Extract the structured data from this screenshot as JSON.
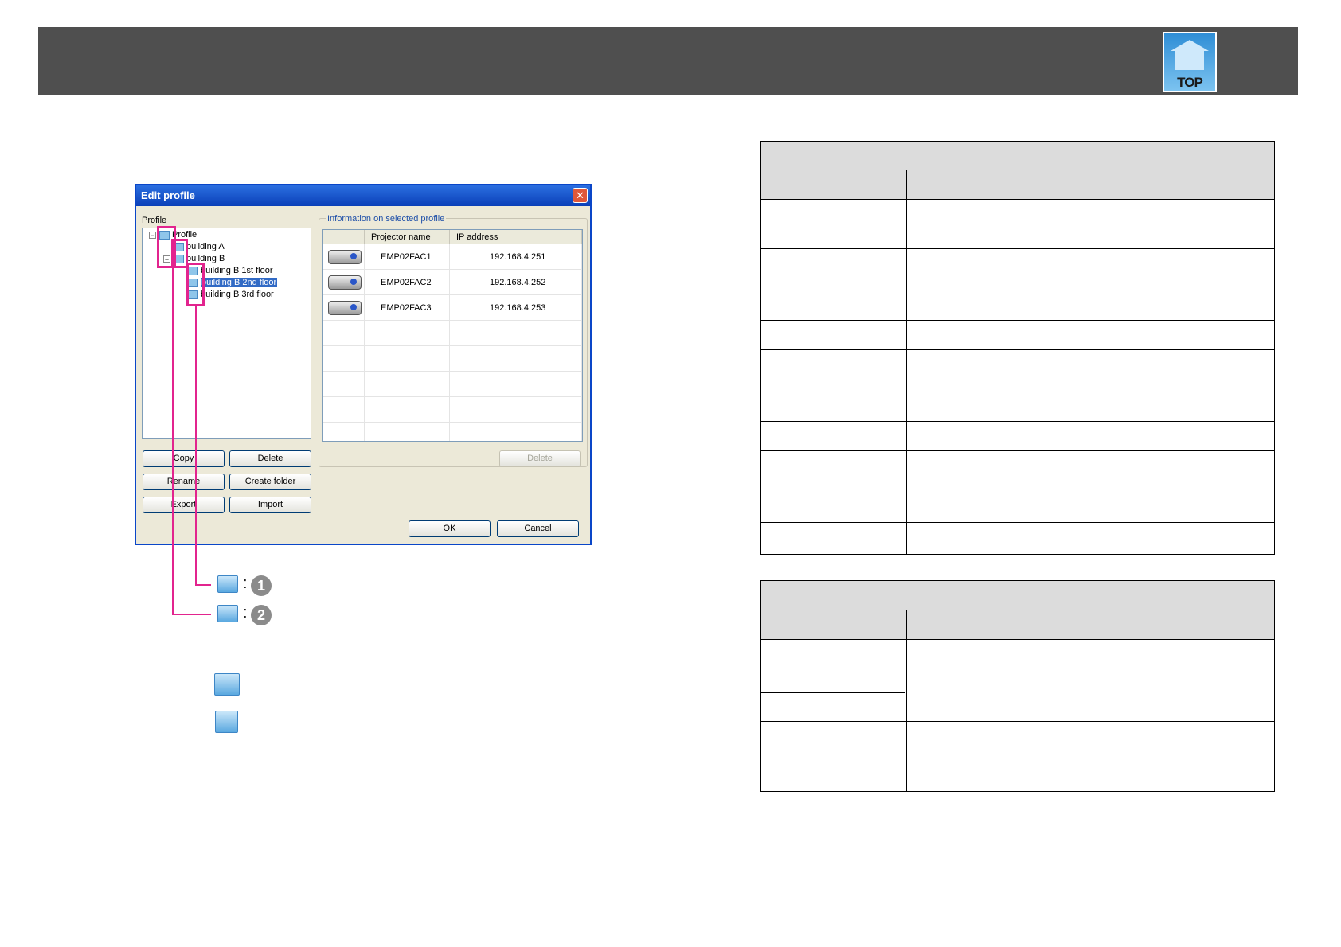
{
  "header": {
    "top_label": "TOP"
  },
  "dialog": {
    "title": "Edit profile",
    "close_glyph": "✕",
    "profile_label": "Profile",
    "info_label": "Information on selected profile",
    "tree": [
      {
        "label": "Profile",
        "expander": "−"
      },
      {
        "label": "building A"
      },
      {
        "label": "building B",
        "expander": "−"
      },
      {
        "label": "building B 1st floor"
      },
      {
        "label": "building B 2nd floor",
        "selected": true
      },
      {
        "label": "building B 3rd floor"
      }
    ],
    "grid": {
      "headers": [
        "",
        "Projector name",
        "IP address"
      ],
      "rows": [
        {
          "name": "EMP02FAC1",
          "ip": "192.168.4.251"
        },
        {
          "name": "EMP02FAC2",
          "ip": "192.168.4.252"
        },
        {
          "name": "EMP02FAC3",
          "ip": "192.168.4.253"
        }
      ]
    },
    "buttons": {
      "copy": "Copy",
      "delete": "Delete",
      "rename": "Rename",
      "create_folder": "Create folder",
      "export": "Export",
      "import": "Import",
      "grid_delete": "Delete",
      "ok": "OK",
      "cancel": "Cancel"
    }
  },
  "legend": {
    "item1": {
      "separator": ":",
      "number": "1",
      "icon": "folder-group-icon"
    },
    "item2": {
      "separator": ":",
      "number": "2",
      "icon": "folder-icon"
    }
  }
}
